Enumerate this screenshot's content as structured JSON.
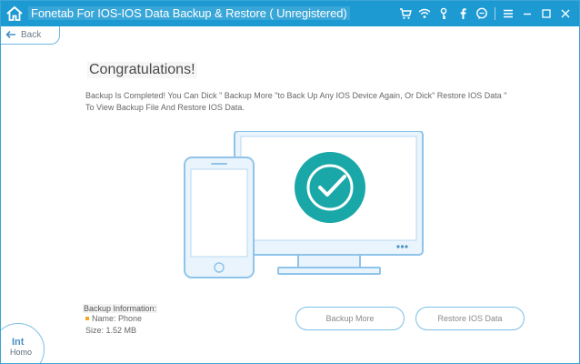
{
  "window": {
    "title": "Fonetab For IOS-IOS Data Backup & Restore ( Unregistered)",
    "accent_color": "#1e9ad3",
    "title_icons": [
      "cart-icon",
      "wifi-icon",
      "key-icon",
      "facebook-icon",
      "chat-icon",
      "menu-icon",
      "minimize-icon",
      "maximize-icon",
      "close-icon"
    ]
  },
  "nav": {
    "back_label": "Back"
  },
  "main": {
    "heading": "Congratulations!",
    "message": "Backup Is Completed! You Can Dick \" Backup More \"to Back Up Any IOS Device Again, Or Dick\" Restore IOS Data \" To View Backup File And Restore IOS Data."
  },
  "backup_info": {
    "title": "Backup Information:",
    "name": "Name: Phone",
    "size": "Size: 1.52 MB",
    "bullet_color": "#f5a623"
  },
  "actions": {
    "backup_more": "Backup More",
    "restore": "Restore IOS Data"
  },
  "home": {
    "glyph": "Int",
    "label": "Homo"
  },
  "illustration": {
    "check_color": "#1aa7a7",
    "device_color": "#7ab8e3"
  }
}
